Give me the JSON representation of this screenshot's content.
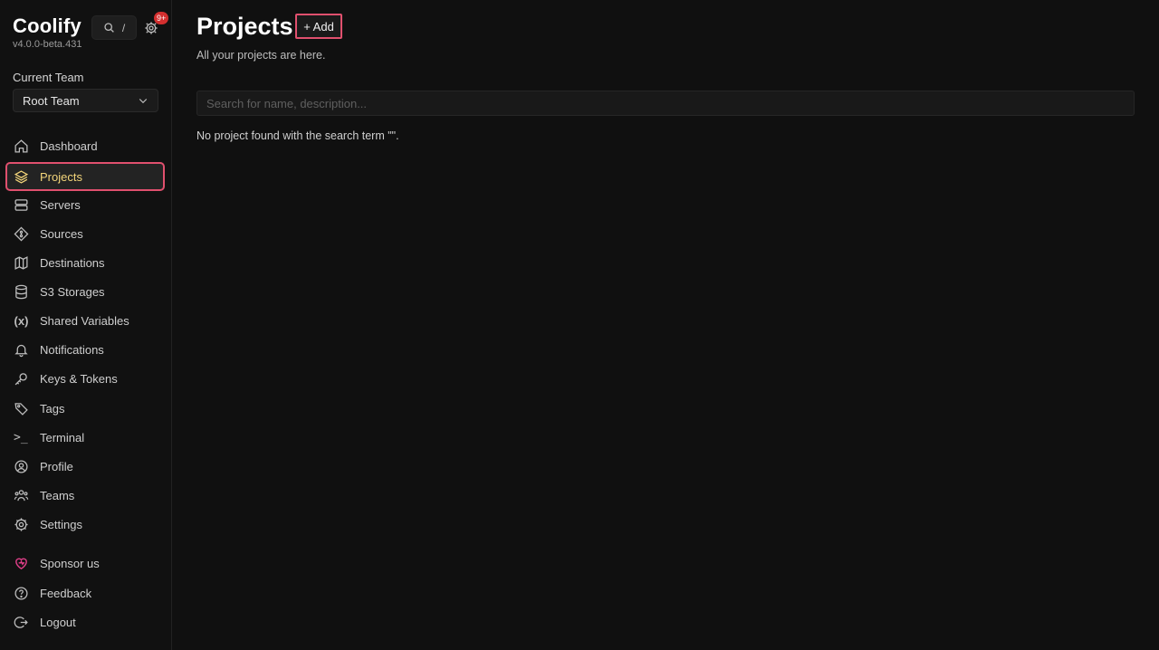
{
  "brand": {
    "title": "Coolify",
    "version": "v4.0.0-beta.431"
  },
  "header": {
    "search_shortcut": "/",
    "notification_badge": "9+"
  },
  "team": {
    "label": "Current Team",
    "selected": "Root Team"
  },
  "sidebar": {
    "items": [
      {
        "label": "Dashboard",
        "icon": "home-icon"
      },
      {
        "label": "Projects",
        "icon": "layers-icon",
        "active": true
      },
      {
        "label": "Servers",
        "icon": "server-icon"
      },
      {
        "label": "Sources",
        "icon": "git-icon"
      },
      {
        "label": "Destinations",
        "icon": "map-icon"
      },
      {
        "label": "S3 Storages",
        "icon": "database-icon"
      },
      {
        "label": "Shared Variables",
        "icon": "variables-icon"
      },
      {
        "label": "Notifications",
        "icon": "bell-icon"
      },
      {
        "label": "Keys & Tokens",
        "icon": "key-icon"
      },
      {
        "label": "Tags",
        "icon": "tag-icon"
      },
      {
        "label": "Terminal",
        "icon": "terminal-icon"
      },
      {
        "label": "Profile",
        "icon": "user-icon"
      },
      {
        "label": "Teams",
        "icon": "users-icon"
      },
      {
        "label": "Settings",
        "icon": "gear-icon"
      },
      {
        "label": "Sponsor us",
        "icon": "heart-icon"
      },
      {
        "label": "Feedback",
        "icon": "help-icon"
      },
      {
        "label": "Logout",
        "icon": "logout-icon"
      }
    ]
  },
  "main": {
    "title": "Projects",
    "add_label": "+ Add",
    "subtitle": "All your projects are here.",
    "search_placeholder": "Search for name, description...",
    "search_value": "",
    "empty_message": "No project found with the search term \"\"."
  },
  "colors": {
    "accent": "#f3d57a",
    "highlight_border": "#e0506e",
    "badge": "#d32f2f",
    "sponsor": "#e23f8a"
  }
}
